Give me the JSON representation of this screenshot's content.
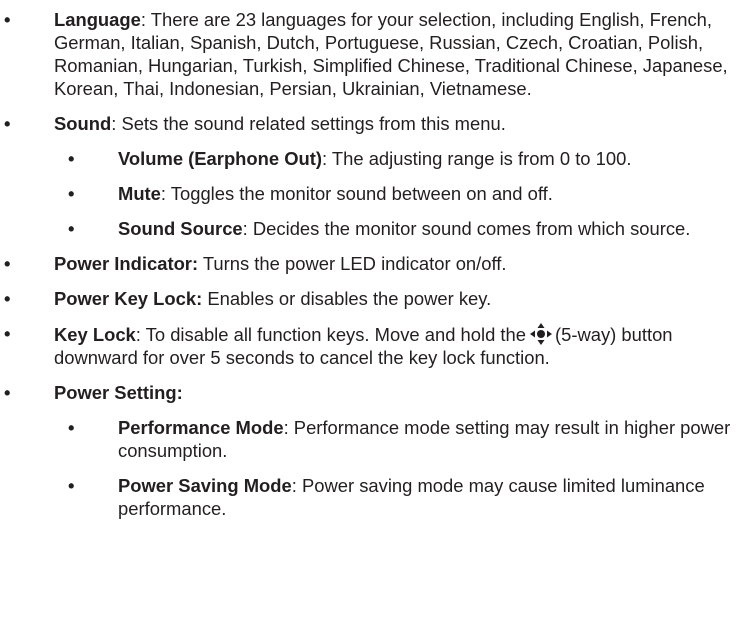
{
  "bullet_char": "•",
  "items": [
    {
      "term": "Language",
      "sep": ": ",
      "text": "There are 23 languages for your selection, including English, French, German, Italian, Spanish, Dutch, Portuguese, Russian, Czech, Croatian, Polish, Romanian, Hungarian, Turkish, Simplified Chinese, Traditional Chinese, Japanese, Korean, Thai, Indonesian, Persian, Ukrainian, Vietnamese."
    },
    {
      "term": "Sound",
      "sep": ": ",
      "text": "Sets the sound related settings from this menu.",
      "subitems": [
        {
          "term": "Volume (Earphone Out)",
          "sep": ": ",
          "text": "The adjusting range is from 0 to 100."
        },
        {
          "term": "Mute",
          "sep": ": ",
          "text": "Toggles the monitor sound between on and off."
        },
        {
          "term": "Sound Source",
          "sep": ": ",
          "text": "Decides the monitor sound comes from which source."
        }
      ]
    },
    {
      "term": "Power Indicator:",
      "sep": " ",
      "text": "Turns the power LED indicator on/off."
    },
    {
      "term": "Power Key Lock:",
      "sep": " ",
      "text": "Enables or disables the power key."
    },
    {
      "term": "Key Lock",
      "sep": ": ",
      "text_before_icon": "To disable all function keys. Move and hold the",
      "icon": "five-way-button-icon",
      "text_after_icon": "(5-way) button downward for over 5 seconds to cancel the key lock function."
    },
    {
      "term": "Power Setting:",
      "sep": "",
      "text": "",
      "subitems": [
        {
          "term": "Performance Mode",
          "sep": ": ",
          "text": "Performance mode setting may result in higher power consumption."
        },
        {
          "term": "Power Saving Mode",
          "sep": ": ",
          "text": "Power saving mode may cause limited luminance performance."
        }
      ]
    }
  ]
}
